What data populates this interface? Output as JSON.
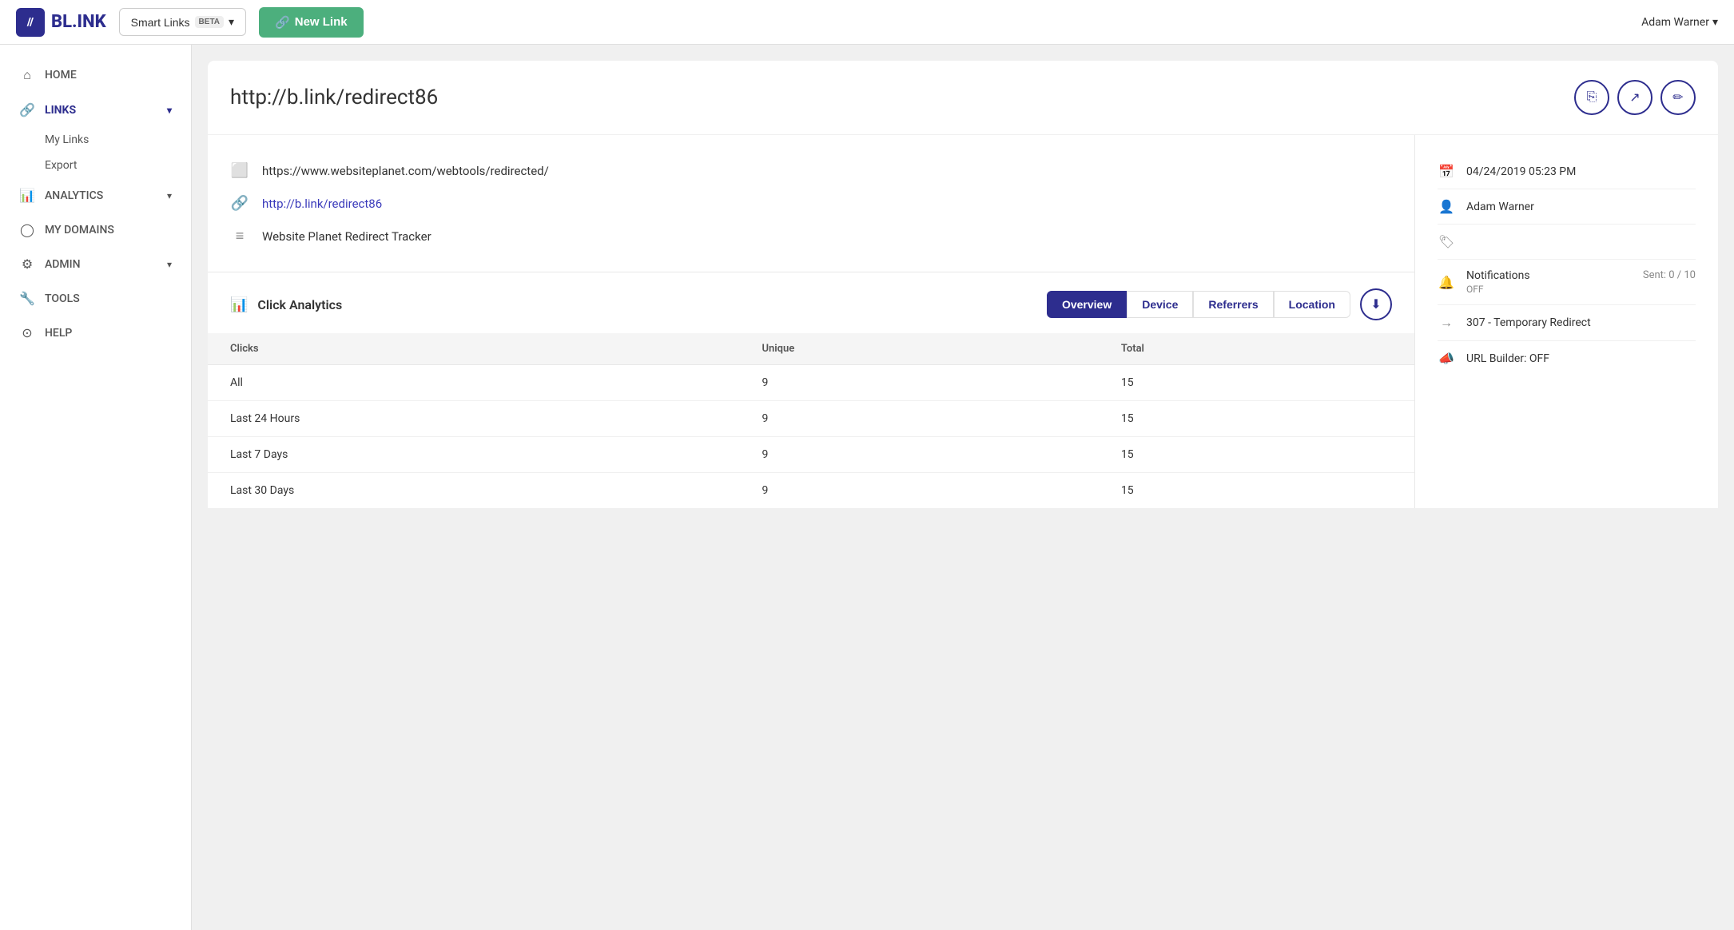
{
  "topnav": {
    "logo_icon": "//",
    "logo_text": "BL.INK",
    "smart_links_label": "Smart Links",
    "beta_label": "BETA",
    "new_link_label": "New Link",
    "user_label": "Adam Warner"
  },
  "sidebar": {
    "items": [
      {
        "id": "home",
        "label": "HOME",
        "icon": "⌂",
        "active": false
      },
      {
        "id": "links",
        "label": "LINKS",
        "icon": "🔗",
        "active": true,
        "expanded": true
      },
      {
        "id": "analytics",
        "label": "ANALYTICS",
        "icon": "📊",
        "active": false
      },
      {
        "id": "my-domains",
        "label": "MY DOMAINS",
        "icon": "◯",
        "active": false
      },
      {
        "id": "admin",
        "label": "ADMIN",
        "icon": "⚙",
        "active": false
      },
      {
        "id": "tools",
        "label": "TOOLS",
        "icon": "🔧",
        "active": false
      },
      {
        "id": "help",
        "label": "HELP",
        "icon": "?",
        "active": false
      }
    ],
    "links_sub": [
      {
        "id": "my-links",
        "label": "My Links"
      },
      {
        "id": "export",
        "label": "Export"
      }
    ]
  },
  "page": {
    "title": "http://b.link/redirect86",
    "actions": {
      "copy": "copy-icon",
      "open": "external-link-icon",
      "edit": "edit-icon"
    }
  },
  "link_info": {
    "destination_url": "https://www.websiteplanet.com/webtools/redirected/",
    "short_url": "http://b.link/redirect86",
    "name": "Website Planet Redirect Tracker"
  },
  "analytics": {
    "title": "Click Analytics",
    "tabs": [
      {
        "id": "overview",
        "label": "Overview",
        "active": true
      },
      {
        "id": "device",
        "label": "Device",
        "active": false
      },
      {
        "id": "referrers",
        "label": "Referrers",
        "active": false
      },
      {
        "id": "location",
        "label": "Location",
        "active": false
      }
    ],
    "table": {
      "headers": [
        "Clicks",
        "Unique",
        "Total"
      ],
      "rows": [
        {
          "label": "All",
          "unique": "9",
          "total": "15"
        },
        {
          "label": "Last 24 Hours",
          "unique": "9",
          "total": "15"
        },
        {
          "label": "Last 7 Days",
          "unique": "9",
          "total": "15"
        },
        {
          "label": "Last 30 Days",
          "unique": "9",
          "total": "15"
        }
      ]
    }
  },
  "right_panel": {
    "date": "04/24/2019 05:23 PM",
    "user": "Adam Warner",
    "tags": "",
    "notifications": {
      "label": "Notifications",
      "status": "OFF",
      "sent_label": "Sent: 0 / 10"
    },
    "redirect_type": "307 - Temporary Redirect",
    "url_builder": "URL Builder: OFF"
  }
}
